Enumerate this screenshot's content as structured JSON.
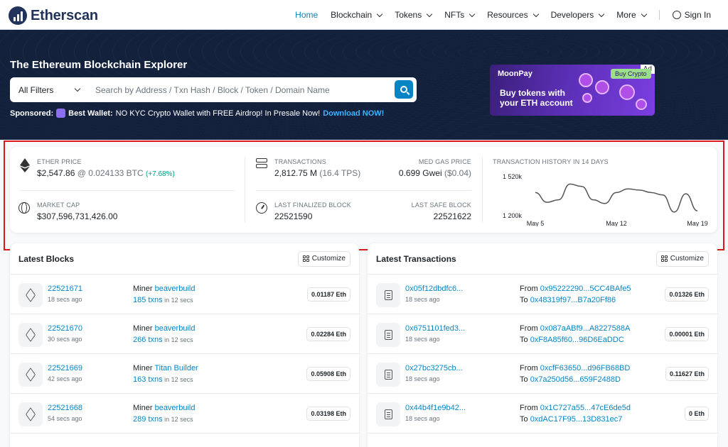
{
  "nav": {
    "logo": "Etherscan",
    "items": [
      {
        "label": "Home",
        "active": true,
        "dropdown": false
      },
      {
        "label": "Blockchain",
        "dropdown": true
      },
      {
        "label": "Tokens",
        "dropdown": true
      },
      {
        "label": "NFTs",
        "dropdown": true
      },
      {
        "label": "Resources",
        "dropdown": true
      },
      {
        "label": "Developers",
        "dropdown": true
      },
      {
        "label": "More",
        "dropdown": true
      }
    ],
    "signin": "Sign In"
  },
  "hero": {
    "title": "The Ethereum Blockchain Explorer",
    "filter": "All Filters",
    "search_placeholder": "Search by Address / Txn Hash / Block / Token / Domain Name",
    "sponsored_label": "Sponsored:",
    "sponsored_name": "Best Wallet:",
    "sponsored_text": "NO KYC Crypto Wallet with FREE Airdrop! In Presale Now!",
    "sponsored_link": "Download NOW!"
  },
  "ad": {
    "badge": "Ad",
    "brand": "MoonPay",
    "button": "Buy Crypto",
    "line1": "Buy tokens with",
    "line2": "your ETH account"
  },
  "stats": {
    "ether_price_label": "ETHER PRICE",
    "ether_price": "$2,547.86",
    "ether_btc": "@ 0.024133 BTC",
    "ether_change": "(+7.68%)",
    "market_cap_label": "MARKET CAP",
    "market_cap": "$307,596,731,426.00",
    "transactions_label": "TRANSACTIONS",
    "transactions": "2,812.75 M",
    "tps": "(16.4 TPS)",
    "gas_label": "MED GAS PRICE",
    "gas": "0.699 Gwei",
    "gas_usd": "($0.04)",
    "finalized_label": "LAST FINALIZED BLOCK",
    "finalized": "22521590",
    "safe_label": "LAST SAFE BLOCK",
    "safe": "22521622",
    "history_label": "TRANSACTION HISTORY IN 14 DAYS",
    "y_ticks": [
      "1 520k",
      "1 200k"
    ],
    "x_ticks": [
      "May 5",
      "May 12",
      "May 19"
    ]
  },
  "chart_data": {
    "type": "line",
    "title": "TRANSACTION HISTORY IN 14 DAYS",
    "ylim": [
      1200000,
      1520000
    ],
    "x": [
      "May 5",
      "May 6",
      "May 7",
      "May 8",
      "May 9",
      "May 10",
      "May 11",
      "May 12",
      "May 13",
      "May 14",
      "May 15",
      "May 16",
      "May 17",
      "May 18",
      "May 19"
    ],
    "values": [
      1390000,
      1310000,
      1330000,
      1460000,
      1440000,
      1330000,
      1300000,
      1390000,
      1420000,
      1410000,
      1390000,
      1370000,
      1230000,
      1380000,
      1240000
    ],
    "x_ticks": [
      "May 5",
      "May 12",
      "May 19"
    ],
    "y_ticks": [
      "1 520k",
      "1 200k"
    ],
    "grid": false
  },
  "blocks": {
    "title": "Latest Blocks",
    "customize": "Customize",
    "rows": [
      {
        "block": "22521671",
        "age": "18 secs ago",
        "miner_label": "Miner",
        "miner": "beaverbuild",
        "txns": "185 txns",
        "txn_time": "in 12 secs",
        "reward": "0.01187 Eth"
      },
      {
        "block": "22521670",
        "age": "30 secs ago",
        "miner_label": "Miner",
        "miner": "beaverbuild",
        "txns": "266 txns",
        "txn_time": "in 12 secs",
        "reward": "0.02284 Eth"
      },
      {
        "block": "22521669",
        "age": "42 secs ago",
        "miner_label": "Miner",
        "miner": "Titan Builder",
        "txns": "163 txns",
        "txn_time": "in 12 secs",
        "reward": "0.05908 Eth"
      },
      {
        "block": "22521668",
        "age": "54 secs ago",
        "miner_label": "Miner",
        "miner": "beaverbuild",
        "txns": "289 txns",
        "txn_time": "in 12 secs",
        "reward": "0.03198 Eth"
      }
    ]
  },
  "transactions": {
    "title": "Latest Transactions",
    "customize": "Customize",
    "rows": [
      {
        "hash": "0x05f12dbdfc6...",
        "age": "18 secs ago",
        "from_label": "From",
        "from": "0x95222290...5CC4BAfe5",
        "to_label": "To",
        "to": "0x48319f97...B7a20Ff86",
        "amount": "0.01326 Eth"
      },
      {
        "hash": "0x6751101fed3...",
        "age": "18 secs ago",
        "from_label": "From",
        "from": "0x087aABf9...A8227588A",
        "to_label": "To",
        "to": "0xF8A85f60...96D6EaDDC",
        "amount": "0.00001 Eth"
      },
      {
        "hash": "0x27bc3275cb...",
        "age": "18 secs ago",
        "from_label": "From",
        "from": "0xcfF63650...d96FB68BD",
        "to_label": "To",
        "to": "0x7a250d56...659F2488D",
        "amount": "0.11627 Eth"
      },
      {
        "hash": "0x44b4f1e9b42...",
        "age": "18 secs ago",
        "from_label": "From",
        "from": "0x1C727a55...47cE6de5d",
        "to_label": "To",
        "to": "0xdAC17F95...13D831ec7",
        "amount": "0 Eth"
      }
    ]
  },
  "colors": {
    "accent": "#0784c3",
    "hero_bg": "#14213d",
    "positive": "#00a186",
    "highlight": "#d9191c"
  },
  "icons": [
    "etherscan-logo-icon",
    "chevron-down-icon",
    "user-circle-icon",
    "search-icon",
    "ethereum-icon",
    "globe-icon",
    "server-icon",
    "gauge-icon",
    "cube-icon",
    "document-icon",
    "grid-icon"
  ]
}
